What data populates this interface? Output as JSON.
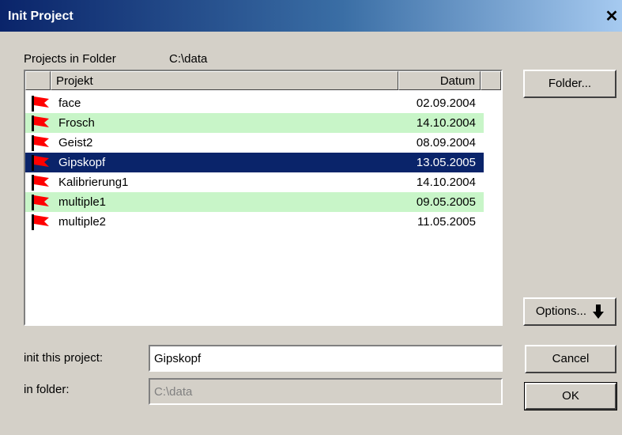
{
  "window": {
    "title": "Init Project"
  },
  "folder_label": "Projects in Folder",
  "folder_path": "C:\\data",
  "columns": {
    "project": "Projekt",
    "date": "Datum"
  },
  "projects": [
    {
      "name": "face",
      "date": "02.09.2004",
      "highlight": "none"
    },
    {
      "name": "Frosch",
      "date": "14.10.2004",
      "highlight": "green"
    },
    {
      "name": "Geist2",
      "date": "08.09.2004",
      "highlight": "none"
    },
    {
      "name": "Gipskopf",
      "date": "13.05.2005",
      "highlight": "selected"
    },
    {
      "name": "Kalibrierung1",
      "date": "14.10.2004",
      "highlight": "none"
    },
    {
      "name": "multiple1",
      "date": "09.05.2005",
      "highlight": "green"
    },
    {
      "name": "multiple2",
      "date": "11.05.2005",
      "highlight": "none"
    }
  ],
  "buttons": {
    "folder": "Folder...",
    "options": "Options...",
    "cancel": "Cancel",
    "ok": "OK"
  },
  "fields": {
    "init_label": "init this project:",
    "init_value": "Gipskopf",
    "folder_label": "in folder:",
    "folder_value": "C:\\data"
  },
  "colors": {
    "highlight_green": "#c8f5c8",
    "selection": "#0a246a",
    "flag": "#ff0000"
  },
  "icons": {
    "row_icon": "red-flag-icon",
    "options_icon": "arrow-down-icon"
  }
}
